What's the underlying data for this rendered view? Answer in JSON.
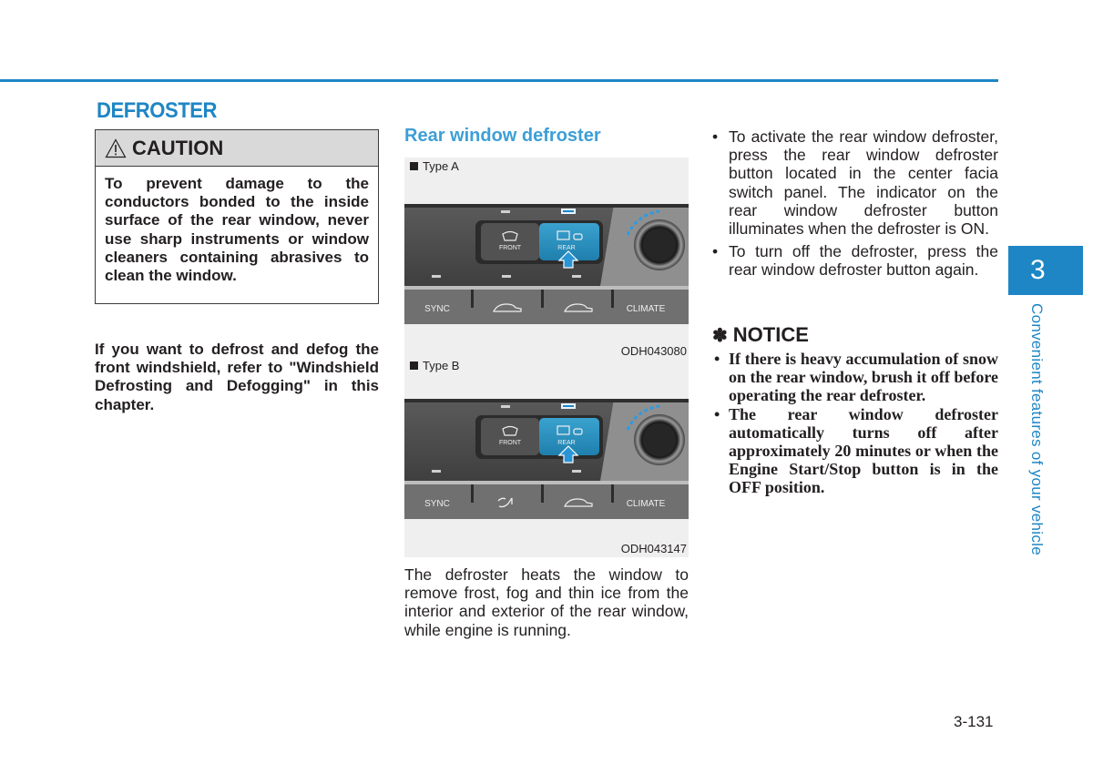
{
  "page": {
    "section_title": "DEFROSTER",
    "page_number": "3-131",
    "chapter_number": "3",
    "chapter_title": "Convenient features of your vehicle",
    "accent_color": "#1e86c5"
  },
  "caution": {
    "icon": "warning-triangle-icon",
    "title": "CAUTION",
    "body": "To prevent damage to the conductors bonded to the inside surface of the rear window, never use sharp instruments or window cleaners containing abrasives to clean the window."
  },
  "refer_note": "If you want to defrost and defog the front windshield, refer to \"Windshield Defrosting and Defogging\" in this chapter.",
  "rear_defroster": {
    "title": "Rear window defroster",
    "figures": [
      {
        "label": "Type A",
        "code": "ODH043080",
        "upper_buttons": [
          "FRONT",
          "REAR"
        ],
        "lower_buttons": [
          "SYNC",
          "recirculation-icon",
          "fresh-air-icon",
          "CLIMATE"
        ]
      },
      {
        "label": "Type B",
        "code": "ODH043147",
        "upper_buttons": [
          "FRONT",
          "REAR"
        ],
        "lower_buttons": [
          "SYNC",
          "air-flow-icon",
          "recirculation-icon",
          "CLIMATE"
        ]
      }
    ],
    "description": "The defroster heats the window to remove frost, fog and thin ice from the interior and exterior of the rear window, while engine is running.",
    "bullets": [
      "To activate the rear window defroster, press the rear window defroster button located in the center facia switch panel. The indicator on the rear window defroster button illuminates when the defroster is ON.",
      "To turn off the defroster, press the rear window defroster button again."
    ]
  },
  "notice": {
    "symbol": "✽",
    "title": "NOTICE",
    "items": [
      "If there is heavy accumulation of snow on the rear window, brush it off before operating the rear defroster.",
      "The rear window defroster automatically turns off after approximately 20 minutes or when the Engine Start/Stop button is in the OFF position."
    ]
  }
}
